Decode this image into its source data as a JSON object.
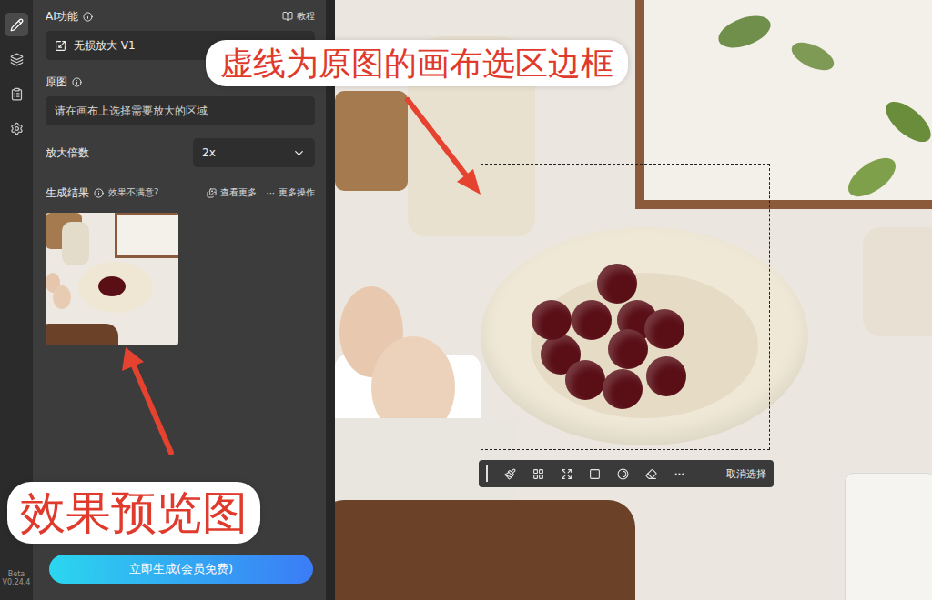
{
  "rail": {
    "items": [
      {
        "selected": true
      },
      {
        "selected": false
      },
      {
        "selected": false
      },
      {
        "selected": false
      }
    ],
    "version": [
      "Beta",
      "V0.24.4"
    ]
  },
  "panel": {
    "ai_function": {
      "label": "AI功能",
      "tutorial": "教程",
      "value": "无损放大 V1"
    },
    "source": {
      "label": "原图",
      "placeholder": "请在画布上选择需要放大的区域"
    },
    "scale": {
      "label": "放大倍数",
      "value": "2x"
    },
    "results": {
      "label": "生成结果",
      "hint": "效果不满意?",
      "view_more": "查看更多",
      "more_glyph": "···",
      "more_actions": "更多操作"
    },
    "generate_button": "立即生成(会员免费)"
  },
  "selection_toolbar": {
    "cancel": "取消选择"
  },
  "annotations": [
    {
      "text": "虚线为原图的画布选区边框"
    },
    {
      "text": "效果预览图"
    }
  ]
}
